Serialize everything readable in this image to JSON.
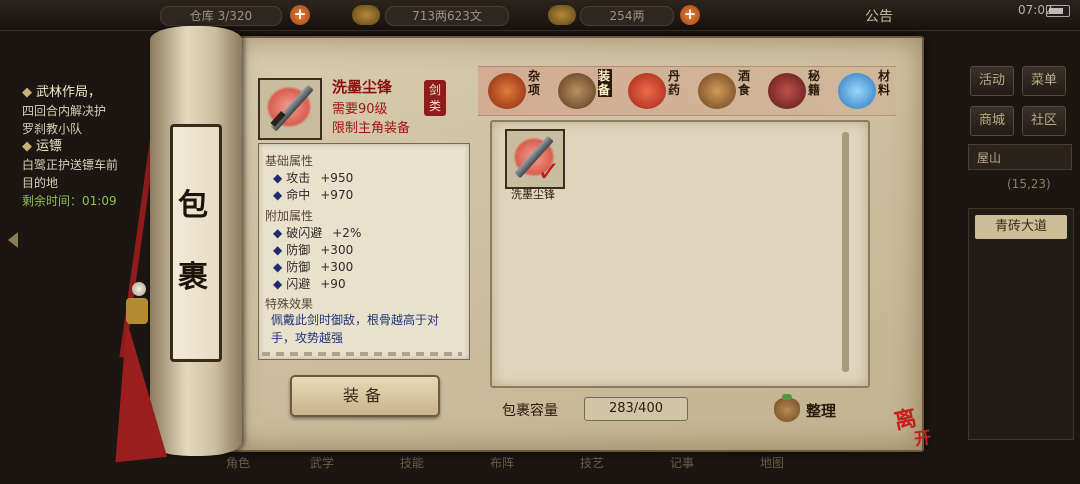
{
  "topbar": {
    "storage": "仓库 3/320",
    "money": "713两623文",
    "gold": "254两",
    "notice": "公告",
    "time": "07:02"
  },
  "quests": {
    "q1_title": "武林作局，",
    "q1_desc1": "四回合内解决护",
    "q1_desc2": "罗刹教小队",
    "q2_title": "运镖",
    "q2_desc1": "白鹭正护送镖车前",
    "q2_desc2": "目的地",
    "remain": "剩余时间：01:09"
  },
  "right_menu": {
    "activity": "活动",
    "menu": "菜单",
    "shop": "商城",
    "community": "社区",
    "location": "屋山",
    "coords": "(15,23)",
    "place": "青砖大道"
  },
  "bottom_nav": [
    "角色",
    "武学",
    "技能",
    "布阵",
    "技艺",
    "记事",
    "地图"
  ],
  "window": {
    "title_char1": "包",
    "title_char2": "裹"
  },
  "item": {
    "name": "洗墨尘锋",
    "level_req": "需要90级",
    "restrict": "限制主角装备",
    "type": "剑类",
    "base_title": "基础属性",
    "base_attrs": [
      {
        "name": "攻击",
        "value": "+950"
      },
      {
        "name": "命中",
        "value": "+970"
      }
    ],
    "extra_title": "附加属性",
    "extra_attrs": [
      {
        "name": "破闪避",
        "value": "+2%"
      },
      {
        "name": "防御",
        "value": "+300"
      },
      {
        "name": "防御",
        "value": "+300"
      },
      {
        "name": "闪避",
        "value": "+90"
      }
    ],
    "special_title": "特殊效果",
    "special_text": "佩戴此剑时御敌，根骨越高于对手，攻势越强"
  },
  "equip_label": "装备",
  "tabs": [
    {
      "label": "杂项",
      "icon": "pot-icon",
      "color": "#b8461e"
    },
    {
      "label": "装备",
      "icon": "weapon-bundle-icon",
      "color": "#7a5a3a"
    },
    {
      "label": "丹药",
      "icon": "pill-icon",
      "color": "#c23a22"
    },
    {
      "label": "酒食",
      "icon": "wine-jar-icon",
      "color": "#9a6a3a"
    },
    {
      "label": "秘籍",
      "icon": "book-icon",
      "color": "#8a2a2a"
    },
    {
      "label": "材料",
      "icon": "crystal-icon",
      "color": "#4aa0d8"
    }
  ],
  "active_tab": 1,
  "inventory": [
    {
      "name": "洗墨尘锋",
      "equipped": true
    }
  ],
  "capacity_label": "包裹容量",
  "capacity_value": "283/400",
  "sort_label": "整理",
  "leave_char1": "离",
  "leave_char2": "开"
}
